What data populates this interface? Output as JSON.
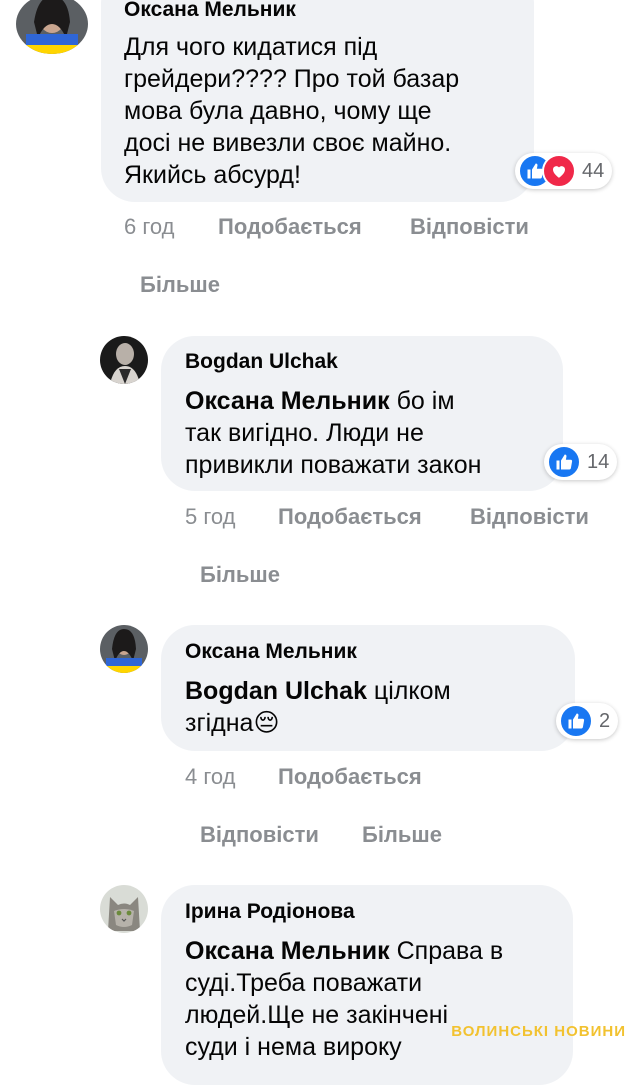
{
  "comments": [
    {
      "author": "Оксана Мельник",
      "lines": [
        "Для чого кидатися під",
        "грейдери???? Про той базар",
        "мова була давно, чому ще",
        "досі не вивезли своє майно.",
        "Якийсь абсурд!"
      ],
      "reaction_count": "44",
      "time": "6 год",
      "like_label": "Подобається",
      "reply_label": "Відповісти",
      "more_label": "Більше"
    },
    {
      "author": "Bogdan Ulchak",
      "mention": "Оксана Мельник",
      "line1_rest": " бо ім",
      "lines": [
        "так вигідно. Люди не",
        "привикли поважати закон"
      ],
      "reaction_count": "14",
      "time": "5 год",
      "like_label": "Подобається",
      "reply_label": "Відповісти",
      "more_label": "Більше"
    },
    {
      "author": "Оксана Мельник",
      "mention": "Bogdan Ulchak",
      "line1_rest": " цілком",
      "line2": "згідна",
      "emoji": "😔",
      "reaction_count": "2",
      "time": "4 год",
      "like_label": "Подобається",
      "reply_label": "Відповісти",
      "more_label": "Більше"
    },
    {
      "author": "Ірина Родіонова",
      "mention": "Оксана Мельник",
      "line1_rest": " Справа в",
      "lines": [
        "суді.Треба поважати",
        "людей.Ще не закінчені",
        "суди і нема вироку"
      ]
    }
  ],
  "watermark": "ВОЛИНСЬКІ НОВИНИ",
  "colors": {
    "bubble": "#f0f2f5",
    "like_blue": "#1877f2",
    "love_red": "#f02849",
    "meta_gray": "#8a8d91"
  }
}
